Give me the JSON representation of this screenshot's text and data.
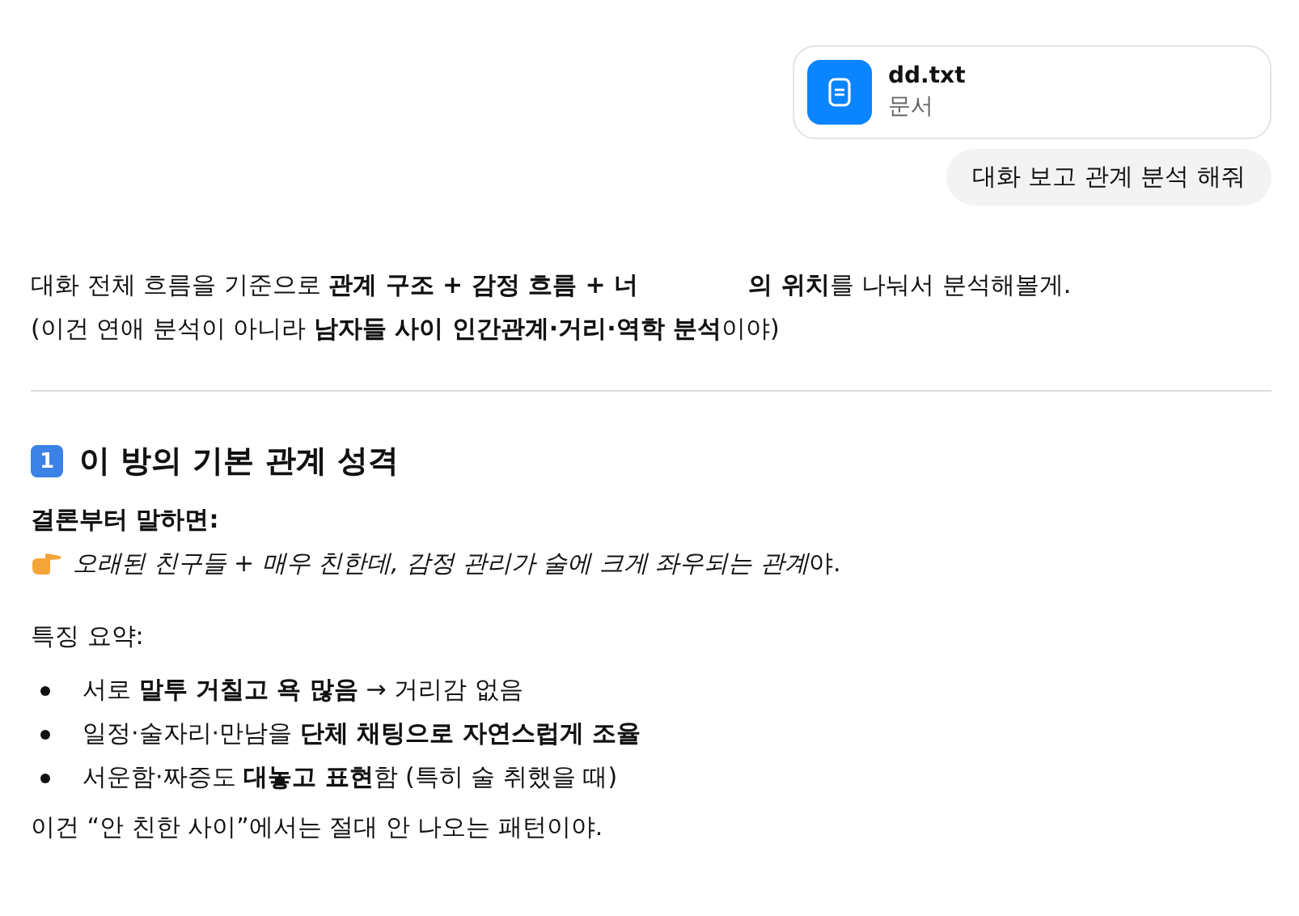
{
  "attachment": {
    "name": "dd.txt",
    "type": "문서"
  },
  "user_message": "대화 보고 관계 분석 해줘",
  "intro": {
    "line1_before": "대화 전체 흐름을 기준으로 **관계 구조 + 감정 흐름 + 너**",
    "line1_after": "**의 위치**를 나눠서 분석해볼게.",
    "line2": "(이건 연애 분석이 아니라 **남자들 사이 인간관계·거리·역학 분석**이야)"
  },
  "section": {
    "number": "1",
    "title": "이 방의 기본 관계 성격",
    "conclusion_label": "결론부터 말하면:",
    "conclusion_italic": "오래된 친구들 + 매우 친한데, 감정 관리가 술에 크게 좌우되는 관계",
    "conclusion_end": "야.",
    "summary_label": "특징 요약:",
    "bullets": [
      "서로 **말투 거칠고 욕 많음** → 거리감 없음",
      "일정·술자리·만남을 **단체 채팅으로 자연스럽게 조율**",
      "서운함·짜증도 **대놓고 표현**함 (특히 술 취했을 때)"
    ],
    "closing": "이건 “안 친한 사이”에서는 절대 안 나오는 패턴이야."
  }
}
